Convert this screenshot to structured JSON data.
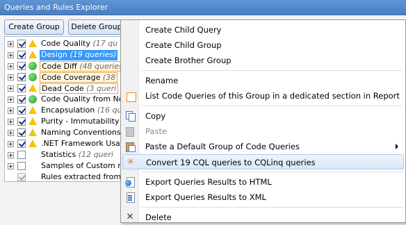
{
  "window": {
    "title": "Queries and Rules Explorer"
  },
  "toolbar": {
    "create_group": "Create Group",
    "delete_group": "Delete Group"
  },
  "tree": {
    "items": [
      {
        "label": "Code Quality",
        "count": "(17 qu",
        "status": "warn",
        "checked": true,
        "expander": true,
        "style": "plain"
      },
      {
        "label": "Design",
        "count": "(19 queries)",
        "status": "warn",
        "checked": true,
        "expander": true,
        "style": "selected"
      },
      {
        "label": "Code Diff",
        "count": "(48 queries",
        "status": "ok",
        "checked": true,
        "expander": true,
        "style": "boxed"
      },
      {
        "label": "Code Coverage",
        "count": "(38",
        "status": "ok",
        "checked": true,
        "expander": true,
        "style": "boxed"
      },
      {
        "label": "Dead Code",
        "count": "(3 queri",
        "status": "warn",
        "checked": true,
        "expander": true,
        "style": "boxed2"
      },
      {
        "label": "Code Quality from No",
        "count": "",
        "status": "ok",
        "checked": true,
        "expander": true,
        "style": "plain"
      },
      {
        "label": "Encapsulation",
        "count": "(16 qu",
        "status": "warn",
        "checked": true,
        "expander": true,
        "style": "plain"
      },
      {
        "label": "Purity - Immutability -",
        "count": "",
        "status": "warn",
        "checked": true,
        "expander": true,
        "style": "plain"
      },
      {
        "label": "Naming Conventions",
        "count": "",
        "status": "warn",
        "checked": true,
        "expander": true,
        "style": "plain"
      },
      {
        "label": ".NET Framework Usag",
        "count": "",
        "status": "warn",
        "checked": true,
        "expander": true,
        "style": "plain"
      },
      {
        "label": "Statistics",
        "count": "(12 queri",
        "status": "none",
        "checked": false,
        "expander": true,
        "style": "plain"
      },
      {
        "label": "Samples of Custom ru",
        "count": "",
        "status": "none",
        "checked": false,
        "expander": true,
        "style": "plain"
      },
      {
        "label": "Rules extracted from",
        "count": "",
        "status": "none",
        "checked": true,
        "dim": true,
        "expander": false,
        "style": "plain"
      }
    ]
  },
  "context_menu": {
    "items": [
      {
        "label": "Create Child Query",
        "icon": "none"
      },
      {
        "label": "Create Child Group",
        "icon": "none"
      },
      {
        "label": "Create Brother Group",
        "icon": "none"
      },
      {
        "sep": true
      },
      {
        "label": "Rename",
        "icon": "none"
      },
      {
        "label": "List Code Queries of this Group in a dedicated section in Report",
        "icon": "checkbox-icon"
      },
      {
        "sep": true
      },
      {
        "label": "Copy",
        "icon": "copy-icon"
      },
      {
        "label": "Paste",
        "icon": "paste-icon",
        "disabled": true
      },
      {
        "label": "Paste a Default Group of Code Queries",
        "icon": "paste-default-icon",
        "submenu": true
      },
      {
        "label": "Convert 19 CQL queries to CQLinq queries",
        "icon": "convert-star-icon",
        "highlighted": true
      },
      {
        "sep": true
      },
      {
        "label": "Export Queries Results to HTML",
        "icon": "export-html-icon"
      },
      {
        "label": "Export Queries Results to XML",
        "icon": "export-xml-icon"
      },
      {
        "sep": true
      },
      {
        "label": "Delete",
        "icon": "delete-icon"
      }
    ]
  }
}
